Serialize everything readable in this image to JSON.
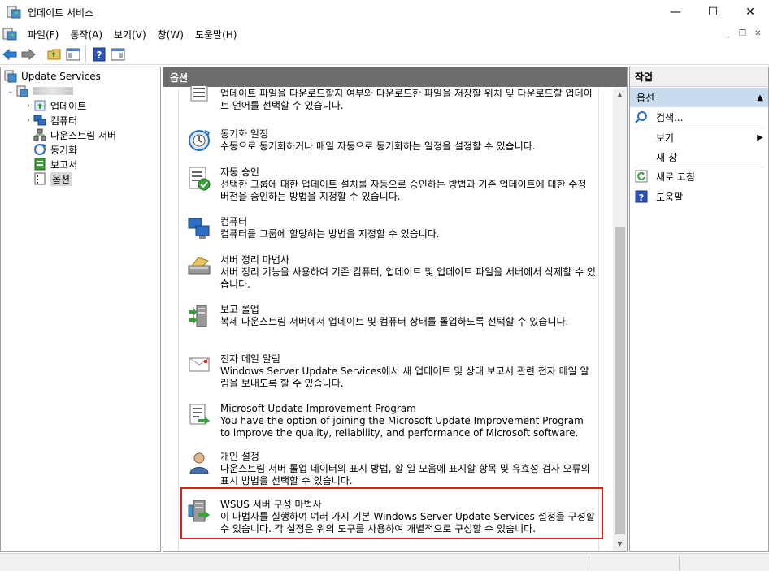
{
  "window": {
    "title": "업데이트 서비스",
    "minimize_glyph": "—",
    "maximize_glyph": "☐",
    "close_glyph": "✕"
  },
  "menu": {
    "file": "파일(F)",
    "action": "동작(A)",
    "view": "보기(V)",
    "window": "창(W)",
    "help": "도움말(H)"
  },
  "tree": {
    "root": "Update Services",
    "server": "",
    "updates": "업데이트",
    "computers": "컴퓨터",
    "downstream": "다운스트림 서버",
    "sync": "동기화",
    "reports": "보고서",
    "options": "옵션"
  },
  "center": {
    "header": "옵션",
    "items": [
      {
        "title": "",
        "desc": "업데이트 파일을 다운로드할지 여부와 다운로드한 파일을 저장할 위치 및 다운로드할 업데이트 언어를 선택할 수 있습니다.",
        "icon": "update-source-icon"
      },
      {
        "title": "동기화 일정",
        "desc": "수동으로 동기화하거나 매일 자동으로 동기화하는 일정을 설정할 수 있습니다.",
        "icon": "sync-schedule-icon"
      },
      {
        "title": "자동 승인",
        "desc": "선택한 그룹에 대한 업데이트 설치를 자동으로 승인하는 방법과 기존 업데이트에 대한 수정 버전을 승인하는 방법을 지정할 수 있습니다.",
        "icon": "auto-approval-icon"
      },
      {
        "title": "컴퓨터",
        "desc": "컴퓨터를 그룹에 할당하는 방법을 지정할 수 있습니다.",
        "icon": "computers-icon"
      },
      {
        "title": "서버 정리 마법사",
        "desc": "서버 정리 기능을 사용하여 기존 컴퓨터, 업데이트 및 업데이트 파일을 서버에서 삭제할 수 있습니다.",
        "icon": "cleanup-wizard-icon"
      },
      {
        "title": "보고 롤업",
        "desc": "복제 다운스트림 서버에서 업데이트 및 컴퓨터 상태를 롤업하도록 선택할 수 있습니다.",
        "icon": "reporting-rollup-icon"
      },
      {
        "title": "전자 메일 알림",
        "desc": "Windows Server Update Services에서 새 업데이트 및 상태 보고서 관련 전자 메일 알림을 보내도록 할 수 있습니다.",
        "icon": "email-notification-icon"
      },
      {
        "title": "Microsoft Update Improvement Program",
        "desc": "You have the option of joining the Microsoft Update Improvement Program to improve the quality, reliability, and performance of Microsoft software.",
        "icon": "improvement-program-icon"
      },
      {
        "title": "개인 설정",
        "desc": "다운스트림 서버 롤업 데이터의 표시 방법, 할 일 모음에 표시할 항목 및 유효성 검사 오류의 표시 방법을 선택할 수 있습니다.",
        "icon": "personalization-icon"
      },
      {
        "title": "WSUS 서버 구성 마법사",
        "desc": "이 마법사를 실행하여 여러 가지 기본 Windows Server Update Services 설정을 구성할 수 있습니다. 각 설정은 위의 도구를 사용하여 개별적으로 구성할 수 있습니다.",
        "icon": "config-wizard-icon"
      }
    ]
  },
  "actions": {
    "header": "작업",
    "section": "옵션",
    "search": "검색...",
    "view": "보기",
    "new_window": "새 창",
    "refresh": "새로 고침",
    "help": "도움말"
  },
  "colors": {
    "highlight_border": "#e11a1a",
    "center_header_bg": "#6d6d6d",
    "action_section_bg": "#c9dbee"
  }
}
